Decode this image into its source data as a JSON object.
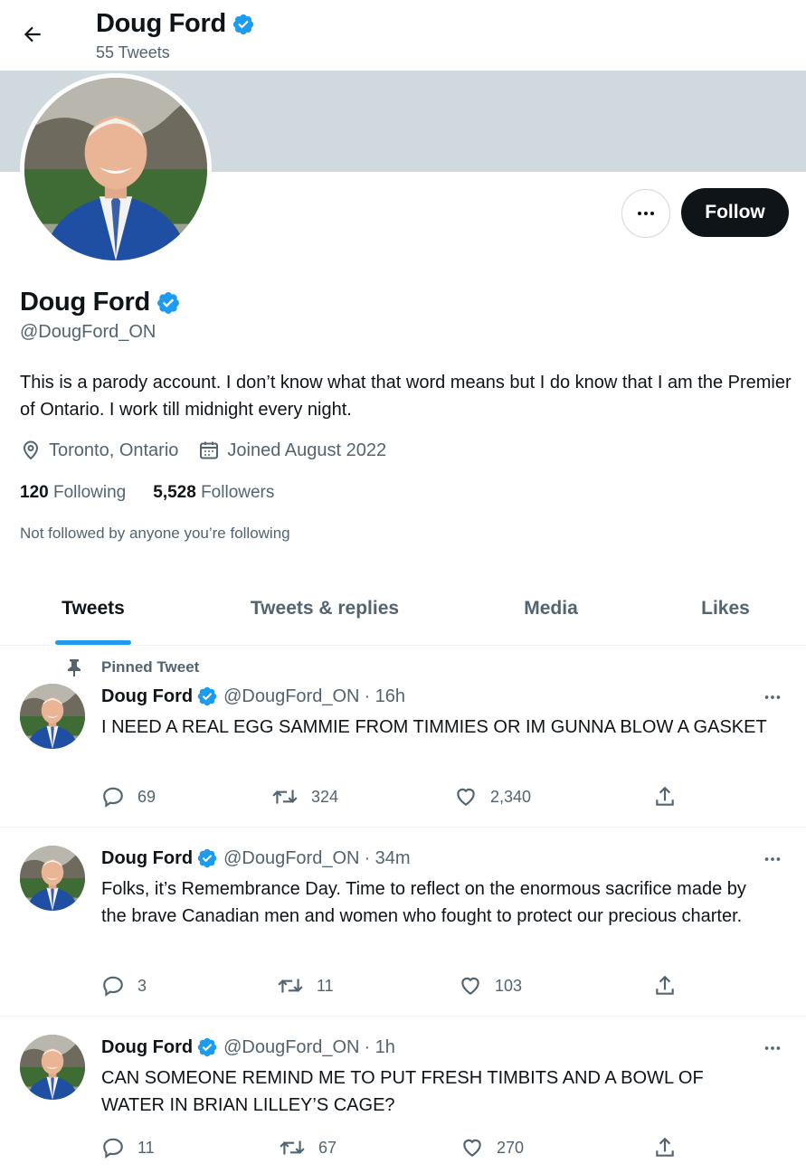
{
  "header": {
    "title": "Doug Ford",
    "tweet_count": "55 Tweets"
  },
  "profile": {
    "name": "Doug Ford",
    "handle": "@DougFord_ON",
    "bio": "This is a parody account. I don’t know what that word means but I do know that I am the Premier of Ontario. I work till midnight every night.",
    "location": "Toronto, Ontario",
    "joined": "Joined August 2022",
    "following_count": "120",
    "following_label": "Following",
    "followers_count": "5,528",
    "followers_label": "Followers",
    "not_followed_note": "Not followed by anyone you’re following",
    "follow_label": "Follow"
  },
  "tabs": [
    {
      "label": "Tweets",
      "active": true
    },
    {
      "label": "Tweets & replies",
      "active": false
    },
    {
      "label": "Media",
      "active": false
    },
    {
      "label": "Likes",
      "active": false
    }
  ],
  "tweets": [
    {
      "pinned_label": "Pinned Tweet",
      "name": "Doug Ford",
      "handle": "@DougFord_ON",
      "time": "· 16h",
      "text": "I NEED A REAL EGG SAMMIE FROM TIMMIES OR IM GUNNA BLOW A GASKET",
      "replies": "69",
      "retweets": "324",
      "likes": "2,340"
    },
    {
      "name": "Doug Ford",
      "handle": "@DougFord_ON",
      "time": "· 34m",
      "text": "Folks, it’s Remembrance Day. Time to reflect on the enormous sacrifice made by the brave Canadian men and women who fought to protect our precious charter.",
      "replies": "3",
      "retweets": "11",
      "likes": "103"
    },
    {
      "name": "Doug Ford",
      "handle": "@DougFord_ON",
      "time": "· 1h",
      "text": "CAN SOMEONE REMIND ME TO PUT FRESH TIMBITS AND A BOWL OF WATER IN BRIAN LILLEY’S CAGE?",
      "replies": "11",
      "retweets": "67",
      "likes": "270"
    }
  ],
  "colors": {
    "accent": "#1d9bf0",
    "text_primary": "#0f1419",
    "text_secondary": "#536471",
    "banner": "#cfd9de",
    "follow_button": "#0f1419"
  },
  "icons": {
    "back": "arrow-left-icon",
    "verified": "verified-badge-icon",
    "more": "more-horizontal-icon",
    "location": "location-pin-icon",
    "calendar": "calendar-icon",
    "pin": "pin-icon",
    "reply": "reply-icon",
    "retweet": "retweet-icon",
    "like": "heart-icon",
    "share": "share-icon"
  }
}
